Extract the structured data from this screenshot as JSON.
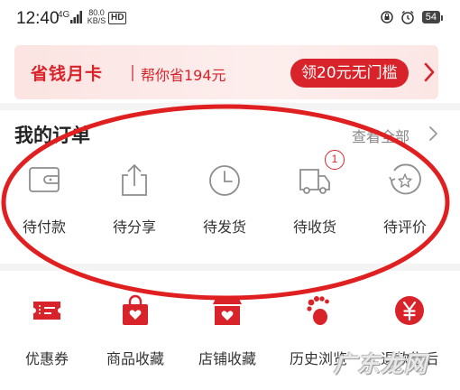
{
  "status_bar": {
    "time": "12:40",
    "network_type": "4G",
    "net_speed_value": "80.0",
    "net_speed_unit": "KB/S",
    "hd": "HD",
    "battery": "54"
  },
  "promo": {
    "title": "省钱月卡",
    "subtitle": "帮你省194元",
    "button_label": "领20元无门槛"
  },
  "orders": {
    "title": "我的订单",
    "view_all": "查看全部",
    "items": [
      {
        "label": "待付款",
        "icon": "wallet-icon"
      },
      {
        "label": "待分享",
        "icon": "share-icon"
      },
      {
        "label": "待发货",
        "icon": "clock-icon"
      },
      {
        "label": "待收货",
        "icon": "truck-icon",
        "badge": "1"
      },
      {
        "label": "待评价",
        "icon": "review-icon"
      }
    ]
  },
  "services": {
    "items": [
      {
        "label": "优惠券",
        "icon": "coupon-icon"
      },
      {
        "label": "商品收藏",
        "icon": "favorite-bag-icon"
      },
      {
        "label": "店铺收藏",
        "icon": "favorite-store-icon"
      },
      {
        "label": "历史浏览",
        "icon": "footprint-icon"
      },
      {
        "label": "退款售后",
        "icon": "refund-icon"
      }
    ]
  },
  "watermark": "广东龙网",
  "colors": {
    "brand_red": "#d8232a",
    "annotation_red": "#e02020",
    "icon_gray": "#8e8e8e"
  }
}
